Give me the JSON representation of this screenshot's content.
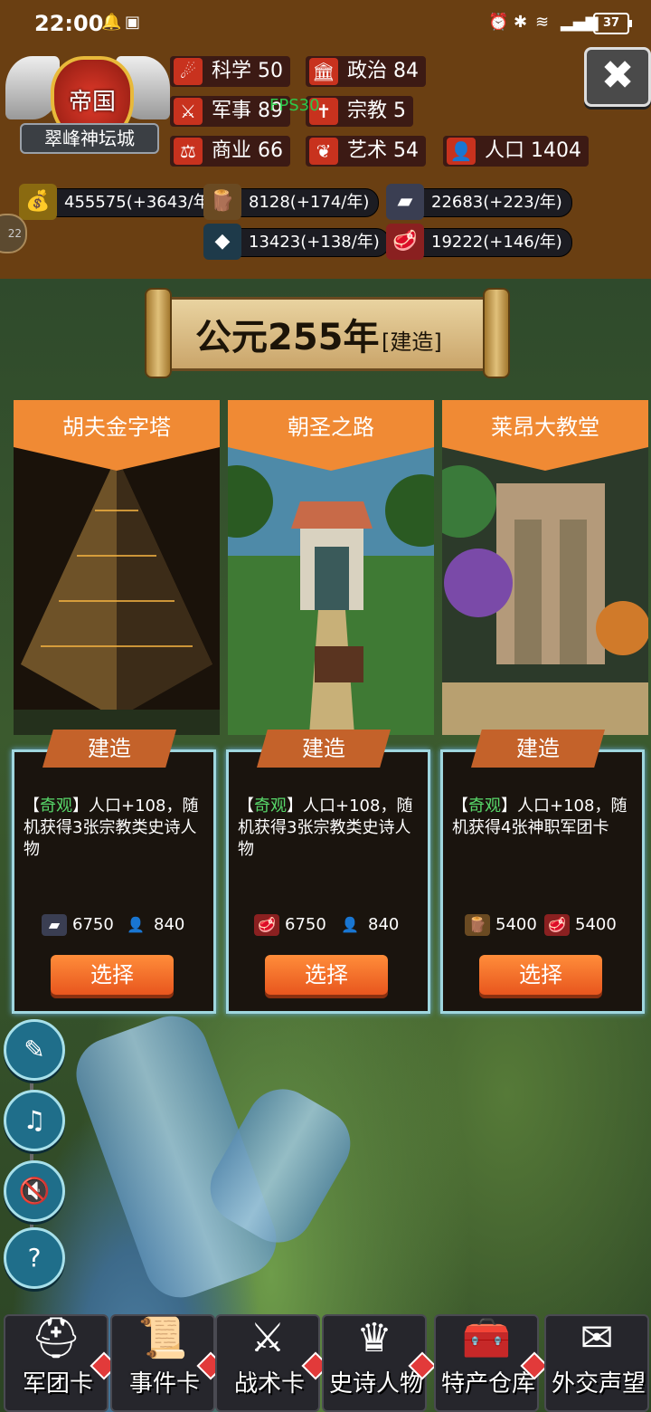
{
  "status_bar": {
    "time": "22:00",
    "battery": "37"
  },
  "empire": {
    "label": "帝国",
    "city": "翠峰神坛城"
  },
  "overlay": {
    "fps": "FPS30"
  },
  "stats": [
    {
      "name": "科学",
      "value": "50",
      "icon": "science-icon",
      "color": "#c8321e"
    },
    {
      "name": "政治",
      "value": "84",
      "icon": "politics-icon",
      "color": "#c8321e"
    },
    {
      "name": "军事",
      "value": "89",
      "icon": "military-icon",
      "color": "#c8321e"
    },
    {
      "name": "宗教",
      "value": "5",
      "icon": "religion-icon",
      "color": "#c8321e"
    },
    {
      "name": "商业",
      "value": "66",
      "icon": "commerce-icon",
      "color": "#c8321e"
    },
    {
      "name": "艺术",
      "value": "54",
      "icon": "art-icon",
      "color": "#c8321e"
    },
    {
      "name": "人口",
      "value": "1404",
      "icon": "population-icon",
      "color": "#c8321e"
    }
  ],
  "resources": [
    {
      "icon": "gold-icon",
      "value": "455575(+3643/年)"
    },
    {
      "icon": "wood-icon",
      "value": "8128(+174/年)"
    },
    {
      "icon": "stone-icon",
      "value": "22683(+223/年)"
    },
    {
      "icon": "iron-icon",
      "value": "13423(+138/年)"
    },
    {
      "icon": "meat-icon",
      "value": "19222(+146/年)"
    }
  ],
  "side_tab": {
    "label": "22"
  },
  "era": {
    "year": "公元255年",
    "mode": "[建造]"
  },
  "cards": [
    {
      "title": "胡夫金字塔",
      "banner": "建造",
      "tag": "奇观",
      "desc_bracket_open": "【",
      "desc_bracket_close": "】",
      "desc_rest": "人口+108，随机获得3张宗教类史诗人物",
      "costs": [
        {
          "icon": "stone-icon",
          "value": "6750"
        },
        {
          "icon": "population-icon",
          "value": "840"
        }
      ],
      "button": "选择"
    },
    {
      "title": "朝圣之路",
      "banner": "建造",
      "tag": "奇观",
      "desc_bracket_open": "【",
      "desc_bracket_close": "】",
      "desc_rest": "人口+108，随机获得3张宗教类史诗人物",
      "costs": [
        {
          "icon": "meat-icon",
          "value": "6750"
        },
        {
          "icon": "population-icon",
          "value": "840"
        }
      ],
      "button": "选择"
    },
    {
      "title": "莱昂大教堂",
      "banner": "建造",
      "tag": "奇观",
      "desc_bracket_open": "【",
      "desc_bracket_close": "】",
      "desc_rest": "人口+108，随机获得4张神职军团卡",
      "costs": [
        {
          "icon": "wood-icon",
          "value": "5400"
        },
        {
          "icon": "meat-icon",
          "value": "5400"
        }
      ],
      "button": "选择"
    }
  ],
  "side_buttons": [
    {
      "icon": "book-icon"
    },
    {
      "icon": "music-off-icon"
    },
    {
      "icon": "sound-off-icon"
    },
    {
      "icon": "help-icon"
    }
  ],
  "bottom_nav": [
    {
      "label": "军团卡",
      "icon": "helmet-icon"
    },
    {
      "label": "事件卡",
      "icon": "scroll-icon"
    },
    {
      "label": "战术卡",
      "icon": "shield-swords-icon"
    },
    {
      "label": "史诗人物",
      "icon": "crown-icon"
    },
    {
      "label": "特产仓库",
      "icon": "chest-icon"
    },
    {
      "label": "外交声望",
      "icon": "letter-icon"
    }
  ]
}
